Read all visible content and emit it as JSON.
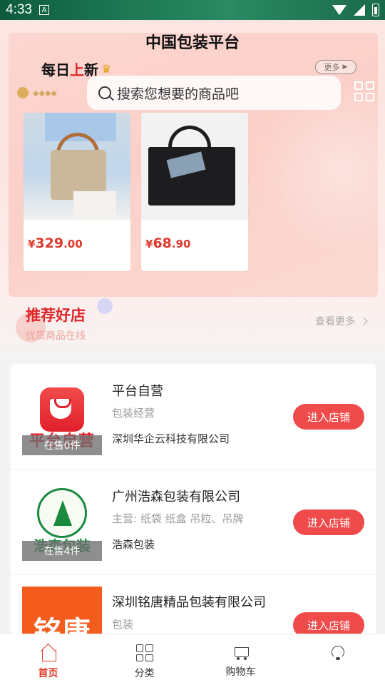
{
  "status_bar": {
    "time": "4:33",
    "indicator": "A"
  },
  "header": {
    "title": "中国包装平台",
    "daily_new_prefix": "每日",
    "daily_new_highlight": "上",
    "daily_new_suffix": "新",
    "more_label": "更多",
    "search_placeholder": "搜索您想要的商品吧"
  },
  "products": [
    {
      "price_symbol": "¥",
      "price_int": "329",
      "price_dec": ".00"
    },
    {
      "price_symbol": "¥",
      "price_int": "68",
      "price_dec": ".90"
    }
  ],
  "recommend": {
    "title": "推荐好店",
    "subtitle": "优质商品在线",
    "view_more": "查看更多"
  },
  "shops": [
    {
      "logo_text": "平台自营",
      "on_sale": "在售0件",
      "name": "平台自营",
      "business": "包装经营",
      "company": "深圳华企云科技有限公司",
      "enter_label": "进入店铺"
    },
    {
      "logo_text": "浩森包装",
      "on_sale": "在售4件",
      "name": "广州浩森包装有限公司",
      "business": "主营:  纸袋 纸盒 吊粒、吊牌",
      "company": "浩森包装",
      "enter_label": "进入店铺"
    },
    {
      "logo_text": "铭唐",
      "on_sale": "",
      "name": "深圳铭唐精品包装有限公司",
      "business": "包装",
      "company": "",
      "enter_label": "进入店铺"
    }
  ],
  "bottom_nav": {
    "items": [
      {
        "label": "首页",
        "icon": "home-icon",
        "active": true
      },
      {
        "label": "分类",
        "icon": "category-icon",
        "active": false
      },
      {
        "label": "购物车",
        "icon": "cart-icon",
        "active": false
      },
      {
        "label": "",
        "icon": "service-icon",
        "active": false
      }
    ]
  },
  "colors": {
    "accent": "#e0382c",
    "button": "#ef4b4b",
    "title_red": "#e0262b"
  }
}
